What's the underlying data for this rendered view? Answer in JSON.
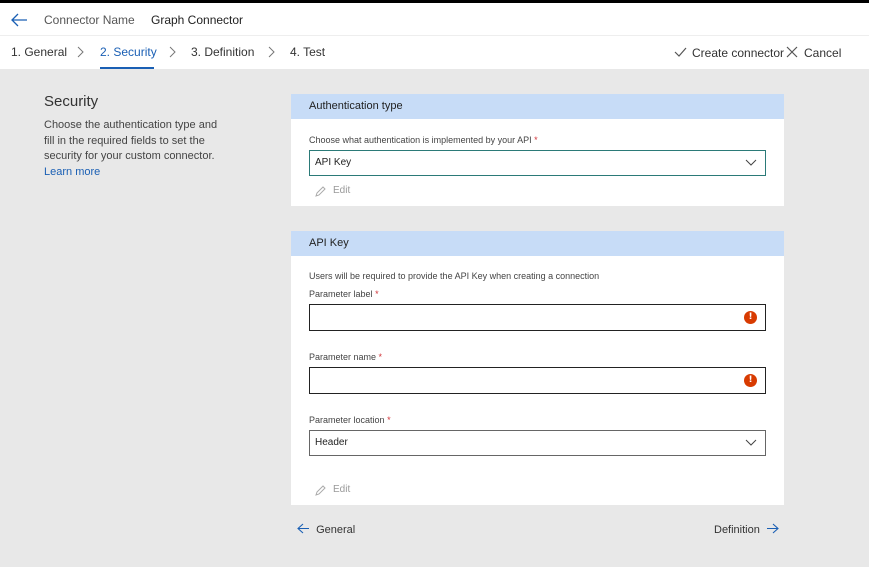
{
  "header": {
    "connector_name_label": "Connector Name",
    "connector_name_value": "Graph Connector"
  },
  "tabs": [
    {
      "label": "1. General"
    },
    {
      "label": "2. Security"
    },
    {
      "label": "3. Definition"
    },
    {
      "label": "4. Test"
    }
  ],
  "actions": {
    "create": "Create connector",
    "cancel": "Cancel"
  },
  "sidebar": {
    "title": "Security",
    "description": "Choose the authentication type and fill in the required fields to set the security for your custom connector.",
    "learn_more": "Learn more"
  },
  "auth_card": {
    "header": "Authentication type",
    "field_label": "Choose what authentication is implemented by your API",
    "required_mark": "*",
    "selected_value": "API Key",
    "edit_label": "Edit"
  },
  "apikey_card": {
    "header": "API Key",
    "info": "Users will be required to provide the API Key when creating a connection",
    "param_label": "Parameter label",
    "param_name": "Parameter name",
    "param_location": "Parameter location",
    "required_mark": "*",
    "location_value": "Header",
    "edit_label": "Edit",
    "error_glyph": "!"
  },
  "footer": {
    "prev": "General",
    "next": "Definition"
  },
  "colors": {
    "accent": "#1a5fb4",
    "card_header": "#c7dcf7",
    "error": "#d83b01",
    "required": "#d13438"
  }
}
